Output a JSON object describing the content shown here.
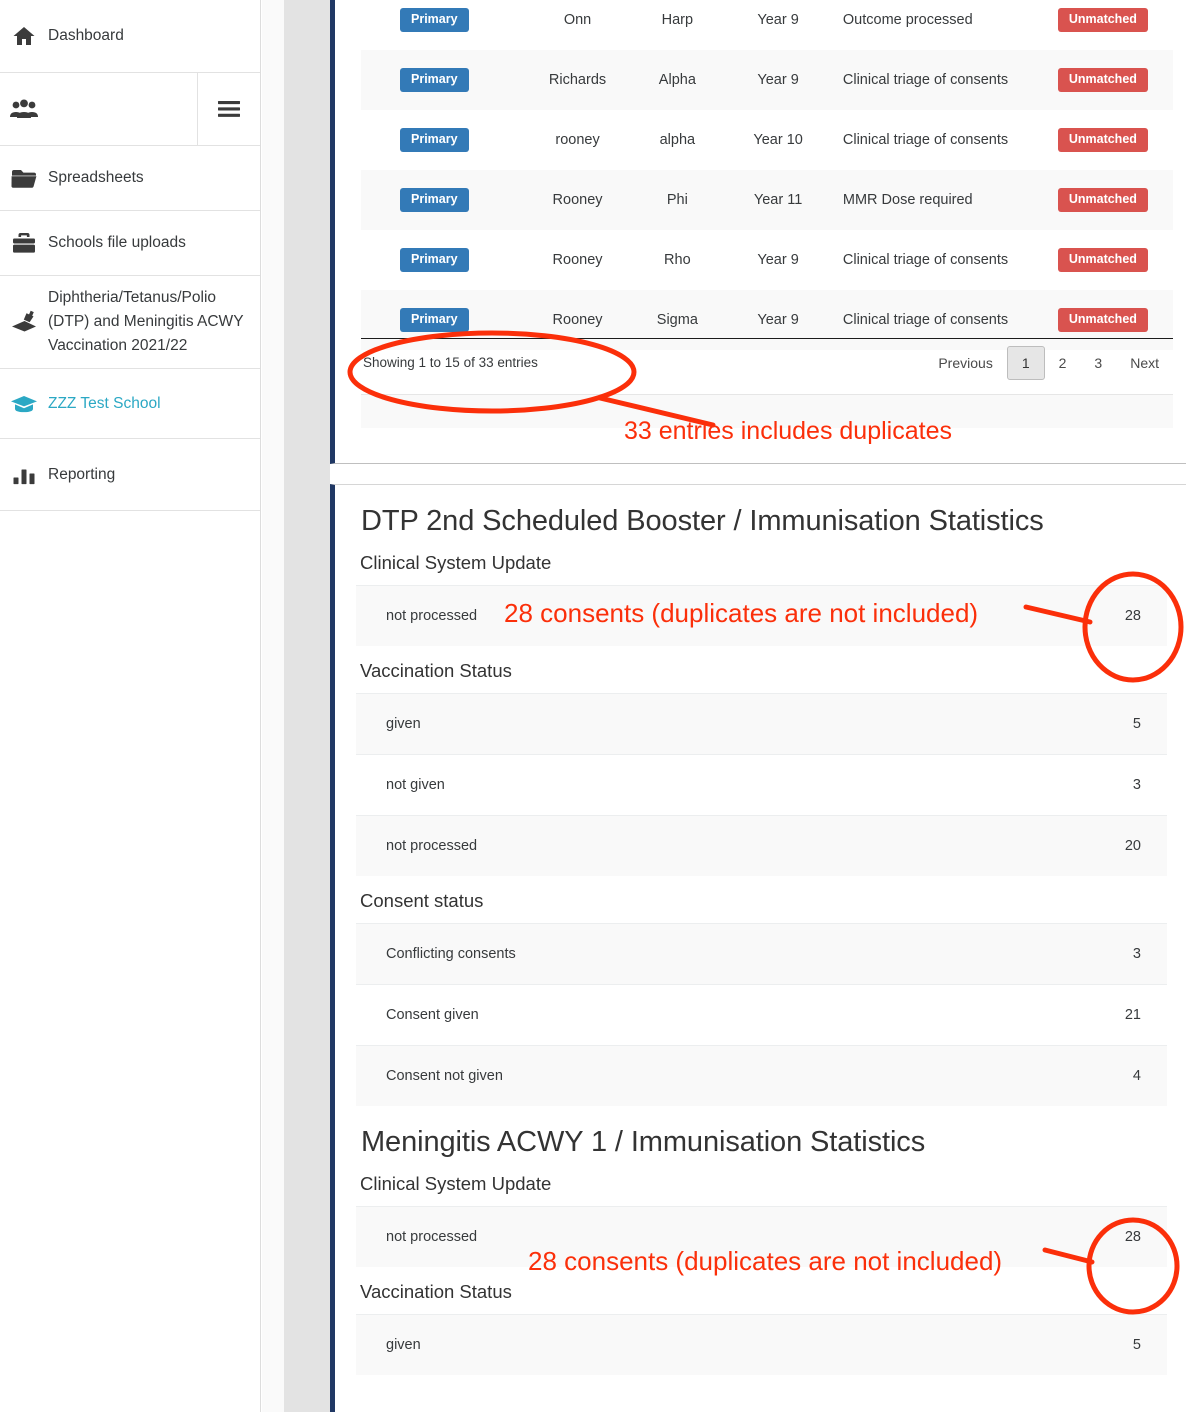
{
  "sidebar": {
    "items": [
      {
        "icon": "home-icon",
        "label": "Dashboard",
        "active": false,
        "name": "sidebar-item-dashboard"
      },
      {
        "icon": "users-icon",
        "label": "",
        "active": false,
        "name": "sidebar-item-users"
      },
      {
        "icon": "folder-icon",
        "label": "Spreadsheets",
        "active": false,
        "name": "sidebar-item-spreadsheets"
      },
      {
        "icon": "briefcase-icon",
        "label": "Schools file uploads",
        "active": false,
        "name": "sidebar-item-schools-file-uploads"
      },
      {
        "icon": "vaccine-icon",
        "label": "Diphtheria/Tetanus/Polio (DTP) and Meningitis ACWY Vaccination 2021/22",
        "active": false,
        "name": "sidebar-item-dtp-campaign"
      },
      {
        "icon": "graduation-icon",
        "label": "ZZZ Test School",
        "active": true,
        "name": "sidebar-item-zzz-test-school"
      },
      {
        "icon": "bar-chart-icon",
        "label": "Reporting",
        "active": false,
        "name": "sidebar-item-reporting"
      }
    ],
    "menu_toggle_icon": "hamburger-icon",
    "active_color": "#2ba8c4"
  },
  "table": {
    "rows": [
      {
        "badge": "Primary",
        "last_name": "Onn",
        "first_name": "Harp",
        "year": "Year 9",
        "status": "Outcome processed",
        "match": "Unmatched"
      },
      {
        "badge": "Primary",
        "last_name": "Richards",
        "first_name": "Alpha",
        "year": "Year 9",
        "status": "Clinical triage of consents",
        "match": "Unmatched"
      },
      {
        "badge": "Primary",
        "last_name": "rooney",
        "first_name": "alpha",
        "year": "Year 10",
        "status": "Clinical triage of consents",
        "match": "Unmatched"
      },
      {
        "badge": "Primary",
        "last_name": "Rooney",
        "first_name": "Phi",
        "year": "Year 11",
        "status": "MMR Dose required",
        "match": "Unmatched"
      },
      {
        "badge": "Primary",
        "last_name": "Rooney",
        "first_name": "Rho",
        "year": "Year 9",
        "status": "Clinical triage of consents",
        "match": "Unmatched"
      },
      {
        "badge": "Primary",
        "last_name": "Rooney",
        "first_name": "Sigma",
        "year": "Year 9",
        "status": "Clinical triage of consents",
        "match": "Unmatched"
      }
    ],
    "footer_info": "Showing 1 to 15 of 33 entries",
    "pager": {
      "previous": "Previous",
      "pages": [
        "1",
        "2",
        "3"
      ],
      "current_page": "1",
      "next": "Next"
    },
    "badge_primary_color": "#337ab7",
    "badge_danger_color": "#d9534f"
  },
  "stats": {
    "sections": [
      {
        "title": "DTP 2nd Scheduled Booster / Immunisation Statistics",
        "groups": [
          {
            "heading": "Clinical System Update",
            "rows": [
              {
                "label": "not processed",
                "value": "28"
              }
            ]
          },
          {
            "heading": "Vaccination Status",
            "rows": [
              {
                "label": "given",
                "value": "5"
              },
              {
                "label": "not given",
                "value": "3"
              },
              {
                "label": "not processed",
                "value": "20"
              }
            ]
          },
          {
            "heading": "Consent status",
            "rows": [
              {
                "label": "Conflicting consents",
                "value": "3"
              },
              {
                "label": "Consent given",
                "value": "21"
              },
              {
                "label": "Consent not given",
                "value": "4"
              }
            ]
          }
        ]
      },
      {
        "title": "Meningitis ACWY 1 / Immunisation Statistics",
        "groups": [
          {
            "heading": "Clinical System Update",
            "rows": [
              {
                "label": "not processed",
                "value": "28"
              }
            ]
          },
          {
            "heading": "Vaccination Status",
            "rows": [
              {
                "label": "given",
                "value": "5"
              }
            ]
          }
        ]
      }
    ]
  },
  "annotations": {
    "color": "#fb2f0a",
    "items": [
      {
        "text": "33 entries includes duplicates",
        "name": "annotation-33-entries"
      },
      {
        "text": "28 consents (duplicates are not included)",
        "name": "annotation-28-consents-dtp"
      },
      {
        "text": "28 consents (duplicates are not included)",
        "name": "annotation-28-consents-acwy"
      }
    ]
  }
}
